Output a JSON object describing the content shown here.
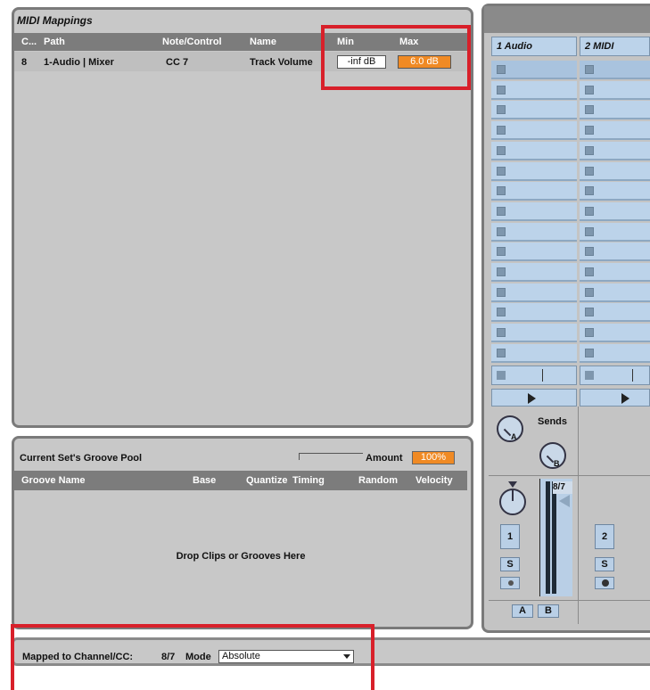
{
  "midi_panel": {
    "title": "MIDI Mappings",
    "columns": [
      "C...",
      "Path",
      "Note/Control",
      "Name",
      "Min",
      "Max"
    ],
    "row": {
      "channel": "8",
      "path": "1-Audio | Mixer",
      "control": "CC 7",
      "name": "Track Volume",
      "min": "-inf dB",
      "max": "6.0 dB"
    }
  },
  "groove_panel": {
    "title": "Current Set's Groove Pool",
    "amount_label": "Amount",
    "amount_value": "100%",
    "columns": [
      "Groove Name",
      "Base",
      "Quantize",
      "Timing",
      "Random",
      "Velocity"
    ],
    "drop_text": "Drop Clips or Grooves Here"
  },
  "tracks": {
    "track1_name": "1 Audio",
    "track2_name": "2 MIDI",
    "sends_label": "Sends",
    "send_a": "A",
    "send_b": "B",
    "track1_number": "1",
    "track2_number": "2",
    "solo": "S",
    "crossfade_a": "A",
    "crossfade_b": "B",
    "meter_readout": "8/7"
  },
  "status": {
    "mapped_label": "Mapped to Channel/CC:",
    "mapped_value": "8/7",
    "mode_label": "Mode",
    "mode_value": "Absolute"
  },
  "colors": {
    "highlight_red": "#d8202a",
    "max_orange": "#f08a24",
    "clip_blue": "#bcd3ea"
  }
}
